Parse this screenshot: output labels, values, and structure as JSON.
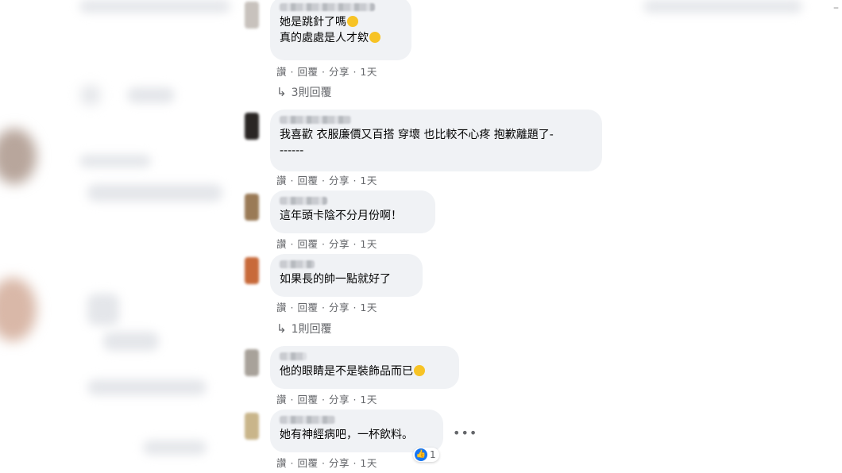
{
  "colors": {
    "bubble": "#f0f2f5",
    "meta_text": "#65676b",
    "like_blue": "#1877f2"
  },
  "actions": {
    "like": "讚",
    "reply": "回覆",
    "share": "分享",
    "sep": "·",
    "time": "1天"
  },
  "comments": [
    {
      "text": "她是跳針了嗎",
      "text2": "真的處處是人才欸",
      "emoji": "rofl-emoji",
      "emoji2": "grin-emoji"
    },
    {
      "text": "我喜歡 衣服廉價又百搭 穿壞 也比較不心疼 抱歉離題了-",
      "text2": "------"
    },
    {
      "text": "這年頭卡陰不分月份啊！"
    },
    {
      "text": "如果長的帥一點就好了"
    },
    {
      "text": "他的眼睛是不是裝飾品而已",
      "emoji": "upside-down-emoji"
    },
    {
      "text": "她有神經病吧，一杯飲料。",
      "reaction_count": "1"
    }
  ],
  "replies": [
    {
      "label": "3則回覆",
      "icon": "reply-arrow-icon"
    },
    {
      "label": "1則回覆",
      "icon": "reply-arrow-icon"
    }
  ],
  "more_icon": "•••",
  "corner_mark": "–"
}
